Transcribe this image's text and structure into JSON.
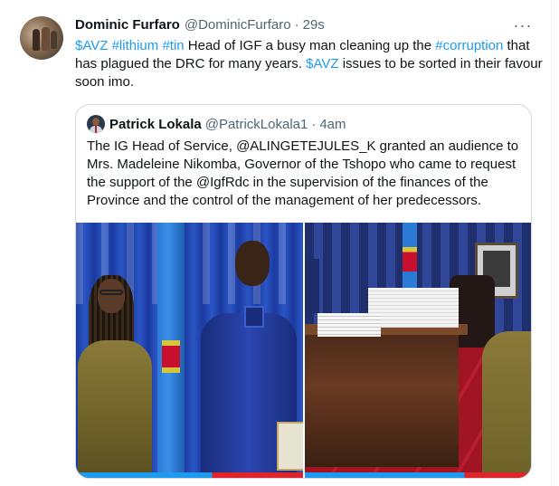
{
  "tweet": {
    "author_name": "Dominic Furfaro",
    "author_handle": "@DominicFurfaro",
    "separator": "·",
    "time": "29s",
    "more_icon": "···",
    "text_segments": [
      {
        "text": "$AVZ",
        "type": "cashtag"
      },
      {
        "text": " ",
        "type": "plain"
      },
      {
        "text": "#lithium",
        "type": "hashtag"
      },
      {
        "text": " ",
        "type": "plain"
      },
      {
        "text": "#tin",
        "type": "hashtag"
      },
      {
        "text": " Head of IGF a busy man cleaning up the ",
        "type": "plain"
      },
      {
        "text": "#corruption",
        "type": "hashtag"
      },
      {
        "text": " that has plagued the DRC for many years.  ",
        "type": "plain"
      },
      {
        "text": "$AVZ",
        "type": "cashtag"
      },
      {
        "text": " issues to be sorted in their favour soon imo.",
        "type": "plain"
      }
    ]
  },
  "quote": {
    "author_name": "Patrick Lokala",
    "author_handle": "@PatrickLokala1",
    "separator": "·",
    "time": "4am",
    "text": "The IG Head of Service, @ALINGETEJULES_K granted an audience to Mrs. Madeleine Nikomba, Governor of the Tshopo who came to request the support of the @IgfRdc in the supervision of the finances of the Province and the control of the management of her predecessors."
  },
  "colors": {
    "link": "#1d9bf0",
    "text": "#0f1419",
    "secondary": "#536471",
    "border": "#cfd9de"
  }
}
